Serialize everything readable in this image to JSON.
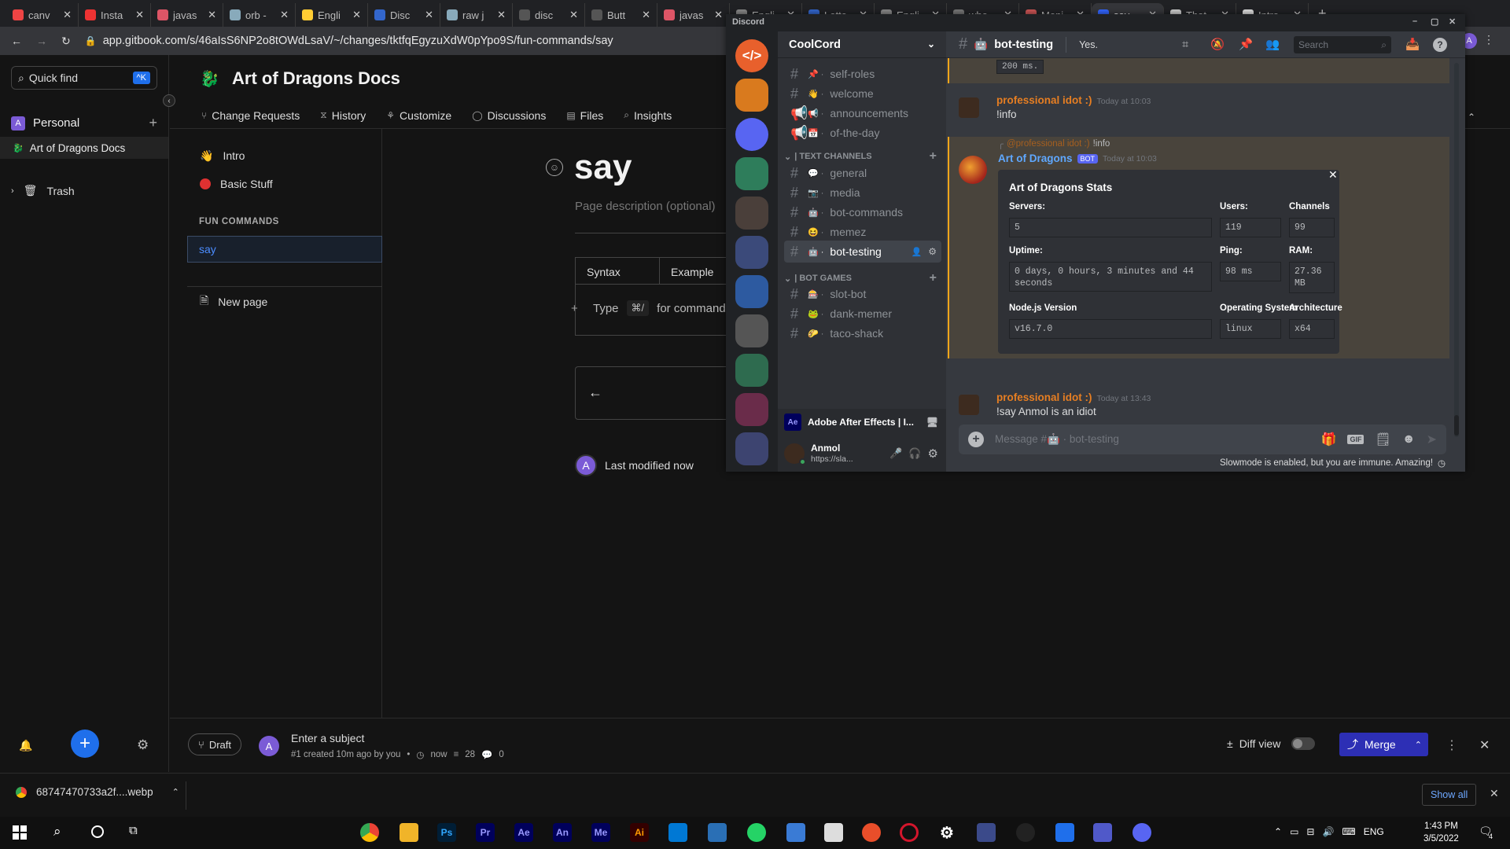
{
  "browser": {
    "tabs": [
      {
        "label": "canv",
        "color": "#e44"
      },
      {
        "label": "Insta",
        "color": "#e33"
      },
      {
        "label": "javas",
        "color": "#d56"
      },
      {
        "label": "orb -",
        "color": "#8ab"
      },
      {
        "label": "Engli",
        "color": "#fc3"
      },
      {
        "label": "Disc",
        "color": "#36c"
      },
      {
        "label": "raw j",
        "color": "#8ab"
      },
      {
        "label": "disc",
        "color": "#555"
      },
      {
        "label": "Butt",
        "color": "#555"
      },
      {
        "label": "javas",
        "color": "#d56"
      },
      {
        "label": "Engli",
        "color": "#888"
      },
      {
        "label": "Lette",
        "color": "#36c"
      },
      {
        "label": "Engli",
        "color": "#888"
      },
      {
        "label": "who",
        "color": "#777"
      },
      {
        "label": "Meni",
        "color": "#c55"
      },
      {
        "label": "say -",
        "color": "#36f"
      },
      {
        "label": "That",
        "color": "#ccc"
      },
      {
        "label": "Intro",
        "color": "#ddd"
      }
    ],
    "url": "app.gitbook.com/s/46aIsS6NP2o8tOWdLsaV/~/changes/tktfqEgyzuXdW0pYpo9S/fun-commands/say"
  },
  "gitbook": {
    "quick_find": "Quick find",
    "quick_find_kbd": "^K",
    "space_section": "Personal",
    "space_name": "Art of Dragons Docs",
    "trash": "Trash",
    "header_title": "Art of Dragons Docs",
    "nav": [
      "Change Requests",
      "History",
      "Customize",
      "Discussions",
      "Files",
      "Insights"
    ],
    "pages": {
      "intro": "Intro",
      "basic": "Basic Stuff",
      "group": "FUN COMMANDS",
      "say": "say",
      "new_page": "New page"
    },
    "page_title": "say",
    "page_desc_placeholder": "Page description (optional)",
    "table_headers": [
      "Syntax",
      "Example"
    ],
    "type_hint": "Type",
    "type_kbd": "⌘/",
    "type_tail": "for command",
    "last_modified": "Last modified now",
    "footer": {
      "draft": "Draft",
      "subject_placeholder": "Enter a subject",
      "meta": "#1 created 10m ago by you",
      "time": "now",
      "lines": "28",
      "comments": "0",
      "diff_view": "Diff view",
      "merge": "Merge"
    }
  },
  "downloads": {
    "file": "68747470733a2f....webp",
    "show_all": "Show all"
  },
  "discord": {
    "app_title": "Discord",
    "server": "CoolCord",
    "channels_top": [
      {
        "name": "self-roles",
        "emoji": "📌"
      },
      {
        "name": "welcome",
        "emoji": "👋"
      },
      {
        "name": "announcements",
        "emoji": "📢"
      },
      {
        "name": "of-the-day",
        "emoji": "📅"
      }
    ],
    "cat_text": "| TEXT CHANNELS",
    "text_channels": [
      {
        "name": "general",
        "emoji": "💬"
      },
      {
        "name": "media",
        "emoji": "📷"
      },
      {
        "name": "bot-commands",
        "emoji": "🤖"
      },
      {
        "name": "memez",
        "emoji": "😆"
      },
      {
        "name": "bot-testing",
        "emoji": "🤖"
      }
    ],
    "cat_games": "| BOT GAMES",
    "game_channels": [
      {
        "name": "slot-bot",
        "emoji": "🎰"
      },
      {
        "name": "dank-memer",
        "emoji": "🐸"
      },
      {
        "name": "taco-shack",
        "emoji": "🌮"
      }
    ],
    "activity": "Adobe After Effects | I...",
    "user": {
      "name": "Anmol",
      "status": "https://sla..."
    },
    "header": {
      "channel": "bot-testing",
      "topic": "Yes.",
      "search_placeholder": "Search"
    },
    "messages": {
      "m1": {
        "author": "professional idot :)",
        "time": "Today at 10:03",
        "text": "!info"
      },
      "reply": {
        "author": "@professional idot :)",
        "text": "!info"
      },
      "bot": {
        "author": "Art of Dragons",
        "tag": "BOT",
        "time": "Today at 10:03"
      },
      "m2": {
        "author": "professional idot :)",
        "time": "Today at 13:43",
        "text": "!say Anmol is an idiot"
      },
      "top_fragment": "200 ms."
    },
    "embed": {
      "title": "Art of Dragons Stats",
      "servers_label": "Servers:",
      "servers": "5",
      "users_label": "Users:",
      "users": "119",
      "channels_label": "Channels",
      "channels": "99",
      "uptime_label": "Uptime:",
      "uptime": "0 days, 0 hours, 3 minutes and 44 seconds",
      "ping_label": "Ping:",
      "ping": "98 ms",
      "ram_label": "RAM:",
      "ram": "27.36 MB",
      "node_label": "Node.js Version",
      "node": "v16.7.0",
      "os_label": "Operating System",
      "os": "linux",
      "arch_label": "Architecture",
      "arch": "x64"
    },
    "input_placeholder": "Message #🤖 · bot-testing",
    "slowmode": "Slowmode is enabled, but you are immune. Amazing!"
  },
  "taskbar": {
    "lang": "ENG",
    "time": "1:43 PM",
    "date": "3/5/2022",
    "notif": "4",
    "apps": [
      {
        "label": "Ps",
        "color": "#001e36",
        "fg": "#31a8ff"
      },
      {
        "label": "Pr",
        "color": "#00005b",
        "fg": "#9999ff"
      },
      {
        "label": "Ae",
        "color": "#00005b",
        "fg": "#9999ff"
      },
      {
        "label": "An",
        "color": "#00005b",
        "fg": "#9999ff"
      },
      {
        "label": "Me",
        "color": "#00005b",
        "fg": "#9999ff"
      },
      {
        "label": "Ai",
        "color": "#330000",
        "fg": "#ff9a00"
      }
    ]
  }
}
